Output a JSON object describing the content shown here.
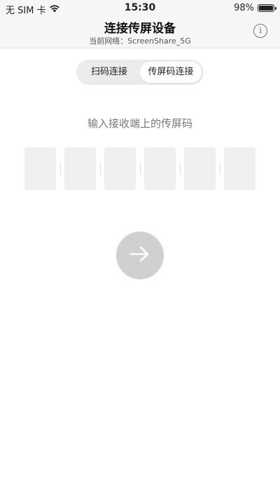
{
  "status_bar": {
    "carrier": "无 SIM 卡",
    "time": "15:30",
    "battery_percent": "98%",
    "battery_level": 0.98
  },
  "header": {
    "title": "连接传屏设备",
    "subtitle": "当前网络：ScreenShare_5G",
    "info_label": "i"
  },
  "tabs": [
    {
      "label": "扫码连接",
      "selected": false
    },
    {
      "label": "传屏码连接",
      "selected": true
    }
  ],
  "main": {
    "prompt": "输入接收端上的传屏码",
    "code_digits": [
      "",
      "",
      "",
      "",
      "",
      ""
    ]
  },
  "icons": {
    "wifi": "wifi-icon",
    "battery": "battery-icon",
    "info": "info-icon",
    "next": "arrow-right-icon"
  },
  "colors": {
    "header_bg": "#f6f6f6",
    "code_box_bg": "#f0f0f0",
    "next_button_bg": "#d0d0d0",
    "prompt_text": "#777777"
  }
}
